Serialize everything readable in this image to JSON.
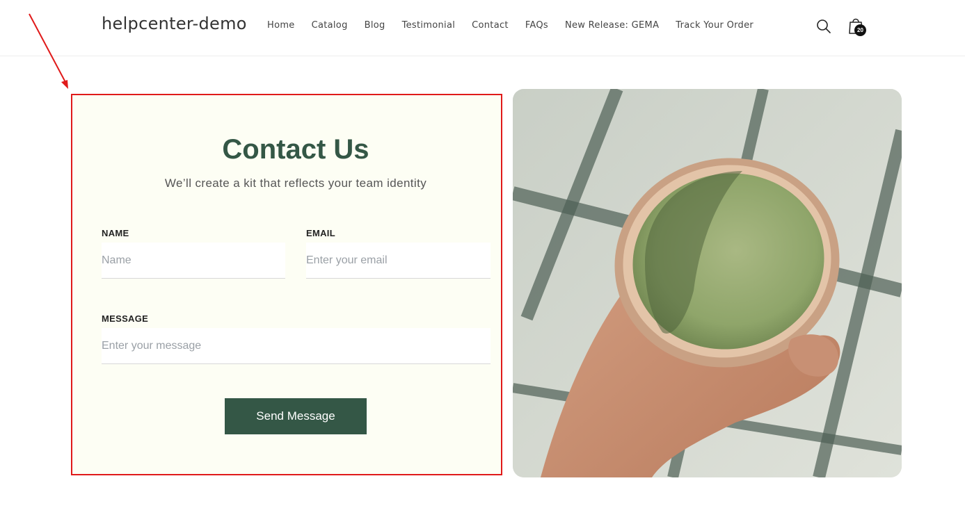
{
  "header": {
    "brand": "helpcenter-demo",
    "nav": [
      "Home",
      "Catalog",
      "Blog",
      "Testimonial",
      "Contact",
      "FAQs",
      "New Release: GEMA",
      "Track Your Order"
    ],
    "search_icon": "search-icon",
    "cart_icon": "cart-icon",
    "cart_count": "20"
  },
  "contact": {
    "title": "Contact Us",
    "subtitle": "We’ll create a kit that reflects your team identity",
    "name_label": "NAME",
    "name_placeholder": "Name",
    "email_label": "EMAIL",
    "email_placeholder": "Enter your email",
    "message_label": "MESSAGE",
    "message_placeholder": "Enter your message",
    "submit_label": "Send Message"
  },
  "colors": {
    "accent": "#345746",
    "panel_bg": "#fdfef4",
    "annotation": "#e01a1a"
  }
}
